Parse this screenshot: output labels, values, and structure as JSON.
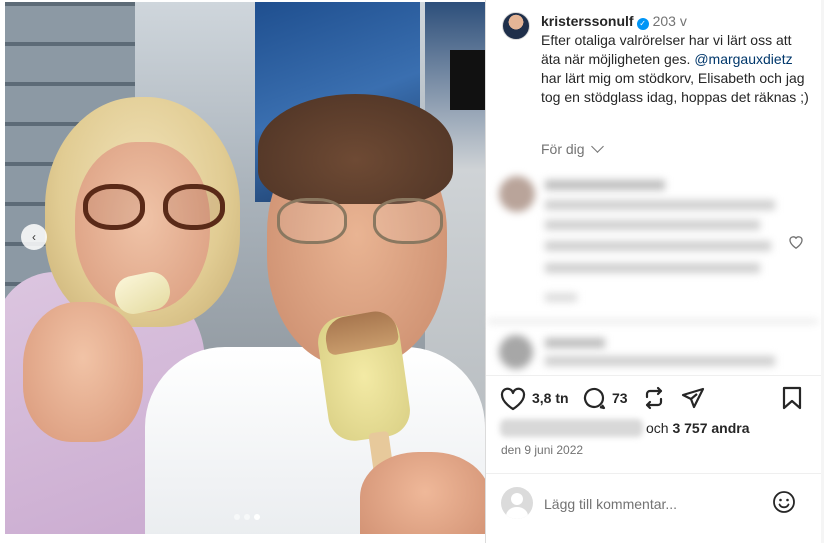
{
  "post": {
    "username": "kristerssonulf",
    "verified_mark": "✓",
    "time_ago": "203 v",
    "caption_part1": "Efter otaliga valrörelser har vi lärt oss att äta när möjligheten ges.",
    "mention": "@margauxdietz",
    "caption_part2": "har lärt mig om stödkorv, Elisabeth och jag tog en stödglass idag, hoppas det räknas ;)",
    "sort_label": "För dig",
    "date": "den 9 juni 2022"
  },
  "actions": {
    "likes_count": "3,8 tn",
    "comments_count": "73",
    "like_icon": "heart-icon",
    "comment_icon": "comment-bubble-icon",
    "repost_icon": "repost-icon",
    "share_icon": "paper-plane-icon",
    "save_icon": "bookmark-icon"
  },
  "likes": {
    "connector": "och",
    "others": "3 757 andra"
  },
  "comment_box": {
    "placeholder": "Lägg till kommentar..."
  },
  "carousel": {
    "prev_glyph": "‹",
    "dots": 3,
    "active_dot": 3
  },
  "colors": {
    "link": "#00376b",
    "verified": "#0095f6",
    "muted": "#737373",
    "text": "#262626"
  }
}
